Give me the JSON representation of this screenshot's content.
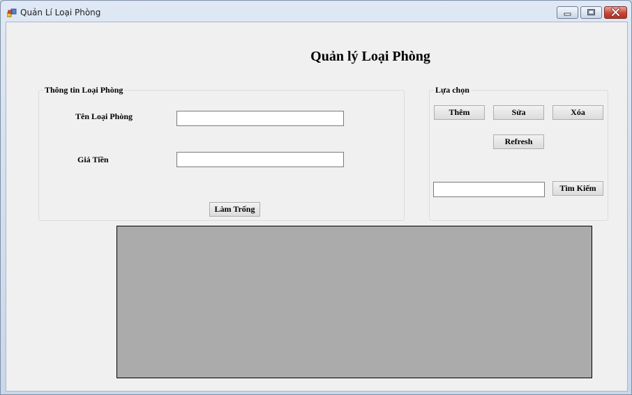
{
  "window": {
    "title": "Quản Lí Loại Phòng"
  },
  "heading": "Quản lý Loại Phòng",
  "info_group": {
    "title": "Thông tin Loại Phòng",
    "room_type_name_label": "Tên Loại Phòng",
    "room_type_name_value": "",
    "price_label": "Giá Tiền",
    "price_value": "",
    "clear_button": "Làm Trống"
  },
  "options_group": {
    "title": "Lựa chọn",
    "add_button": "Thêm",
    "edit_button": "Sửa",
    "delete_button": "Xóa",
    "refresh_button": "Refresh",
    "search_value": "",
    "search_button": "Tìm Kiếm"
  },
  "icons": {
    "app": "app-window-icon",
    "minimize": "minimize-icon",
    "maximize": "maximize-icon",
    "close": "close-icon"
  }
}
